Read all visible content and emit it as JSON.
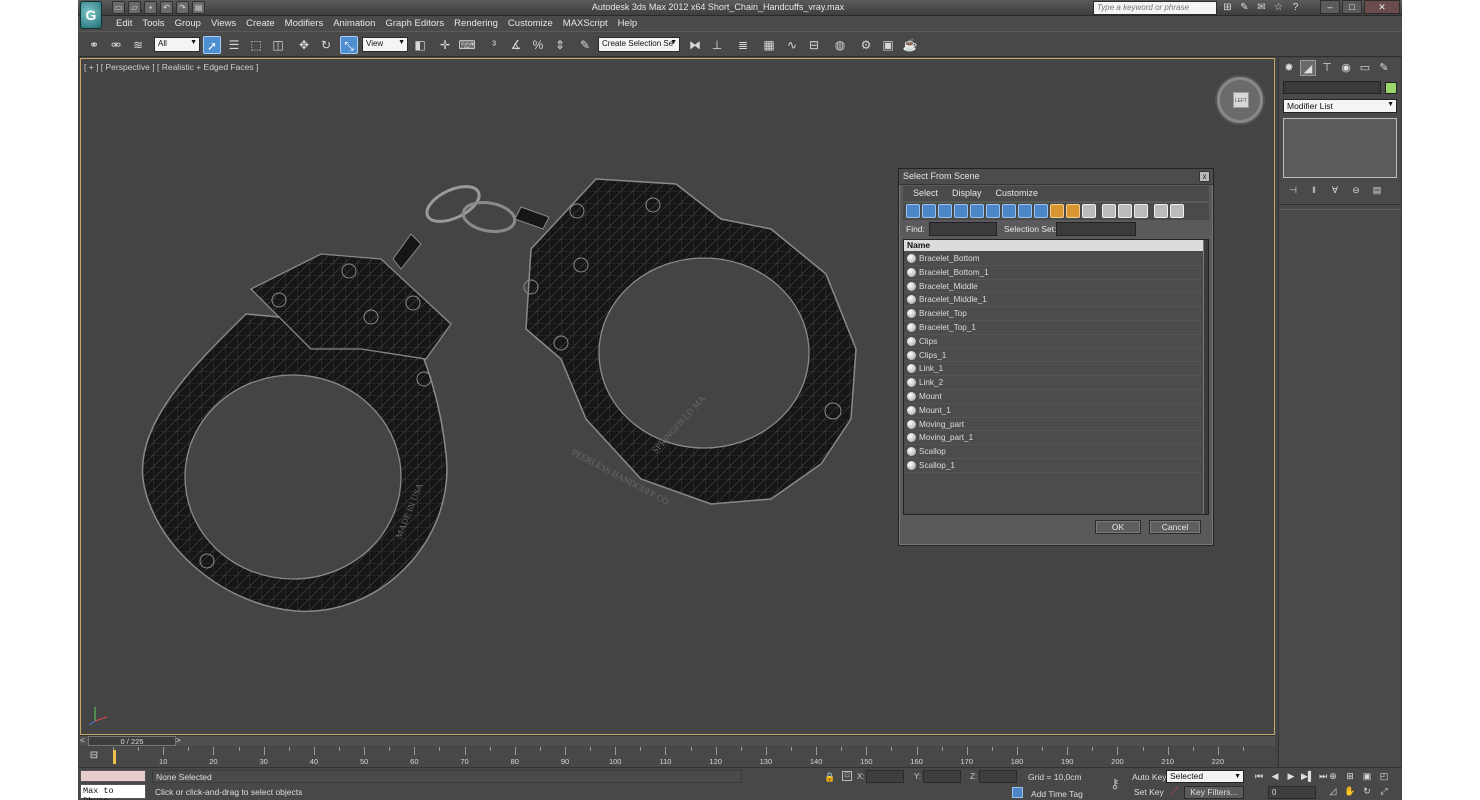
{
  "titlebar": {
    "title": "Autodesk 3ds Max  2012 x64      Short_Chain_Handcuffs_vray.max",
    "search_placeholder": "Type a keyword or phrase",
    "quick_access": [
      "new-file-icon",
      "open-file-icon",
      "save-file-icon",
      "undo-icon",
      "redo-icon",
      "project-folder-icon"
    ],
    "icons": [
      "binoculars-icon",
      "tools-icon",
      "communication-icon",
      "star-icon",
      "help-icon"
    ],
    "window_buttons": [
      "minimize",
      "maximize",
      "close"
    ]
  },
  "menu": [
    "Edit",
    "Tools",
    "Group",
    "Views",
    "Create",
    "Modifiers",
    "Animation",
    "Graph Editors",
    "Rendering",
    "Customize",
    "MAXScript",
    "Help"
  ],
  "toolbar": {
    "filter_value": "All",
    "refcoord_value": "View",
    "selection_set_placeholder": "Create Selection Se"
  },
  "viewport": {
    "label": "[ + ] [ Perspective ] [ Realistic + Edged Faces ]",
    "viewcube_text": "LEFT",
    "model_engraving": [
      "PEERLESS HANDCUFF CO",
      "SPRINGFIELD MA",
      "MADE IN USA"
    ]
  },
  "dialog": {
    "title": "Select From Scene",
    "close": "x",
    "menu": [
      "Select",
      "Display",
      "Customize"
    ],
    "find_label": "Find:",
    "selection_set_label": "Selection Set:",
    "column_header": "Name",
    "items": [
      "Bracelet_Bottom",
      "Bracelet_Bottom_1",
      "Bracelet_Middle",
      "Bracelet_Middle_1",
      "Bracelet_Top",
      "Bracelet_Top_1",
      "Clips",
      "Clips_1",
      "Link_1",
      "Link_2",
      "Mount",
      "Mount_1",
      "Moving_part",
      "Moving_part_1",
      "Scallop",
      "Scallop_1"
    ],
    "ok_label": "OK",
    "cancel_label": "Cancel"
  },
  "command_panel": {
    "modifier_list": "Modifier List",
    "object_color": "#9bd66c"
  },
  "timeline": {
    "frame_display": "0 / 225",
    "ticks": [
      10,
      20,
      30,
      40,
      50,
      60,
      70,
      80,
      90,
      100,
      110,
      120,
      130,
      140,
      150,
      160,
      170,
      180,
      190,
      200,
      210,
      220
    ],
    "current_frame": 0
  },
  "status": {
    "maxscript_label": "Max to Physc",
    "selection_text": "None Selected",
    "prompt_text": "Click or click-and-drag to select objects",
    "x_label": "X:",
    "y_label": "Y:",
    "z_label": "Z:",
    "grid_text": "Grid = 10,0cm",
    "add_time_tag": "Add Time Tag",
    "auto_key": "Auto Key",
    "set_key": "Set Key",
    "selected_option": "Selected",
    "key_filters": "Key Filters...",
    "frame_value": "0"
  },
  "colors": {
    "ui_bg": "#444444",
    "viewport_border": "#c8a96a",
    "accent_blue": "#4f8fd0"
  }
}
